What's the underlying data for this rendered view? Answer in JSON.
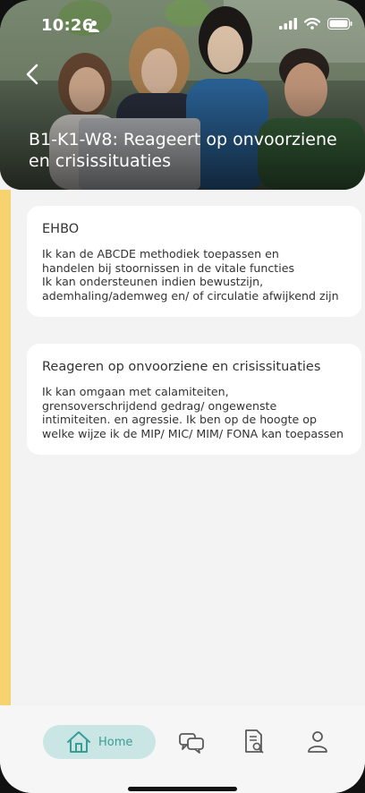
{
  "status_bar": {
    "time": "10:26"
  },
  "header": {
    "title_line1": "B1-K1-W8: Reageert op onvoorziene",
    "title_line2": "en crisissituaties"
  },
  "cards": [
    {
      "title": "EHBO",
      "lines": [
        "Ik kan de ABCDE methodiek toepassen en",
        "handelen bij stoornissen in de vitale functies",
        "Ik kan ondersteunen indien bewustzijn,",
        "ademhaling/ademweg en/ of circulatie afwijkend zijn"
      ]
    },
    {
      "title": "Reageren op onvoorziene en crisissituaties",
      "lines": [
        "Ik kan omgaan met calamiteiten,",
        "grensoverschrijdend gedrag/ ongewenste",
        "intimiteiten. en agressie. Ik ben op de hoogte op",
        "welke wijze ik de MIP/ MIC/ MIM/ FONA kan toepassen"
      ]
    }
  ],
  "nav": {
    "home_label": "Home",
    "icons": [
      "home-icon",
      "chat-icon",
      "document-search-icon",
      "profile-icon"
    ]
  },
  "colors": {
    "accent_yellow": "#f6d36e",
    "nav_active_bg": "#c9e6e4",
    "nav_active_text": "#3a9c97",
    "nav_icon": "#5a5a5a"
  }
}
